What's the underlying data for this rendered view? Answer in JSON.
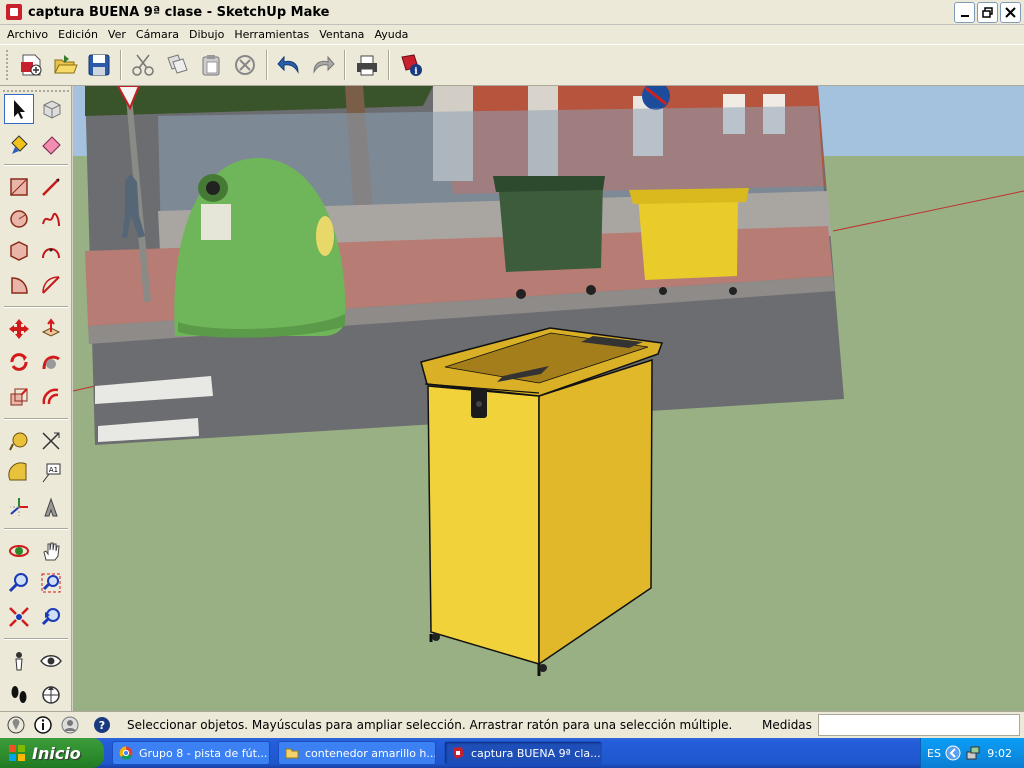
{
  "window": {
    "title": "captura BUENA 9ª clase - SketchUp Make"
  },
  "menu": [
    "Archivo",
    "Edición",
    "Ver",
    "Cámara",
    "Dibujo",
    "Herramientas",
    "Ventana",
    "Ayuda"
  ],
  "toolbar_icons": [
    "new-file-icon",
    "open-folder-icon",
    "save-icon",
    "cut-icon",
    "copy-icon",
    "paste-icon",
    "erase-icon",
    "undo-icon",
    "redo-icon",
    "print-icon",
    "model-info-icon"
  ],
  "palette_icons": [
    "select-icon",
    "make-component-icon",
    "paint-bucket-icon",
    "eraser-icon",
    "rectangle-icon",
    "line-icon",
    "circle-icon",
    "freehand-icon",
    "polygon-icon",
    "arc-icon",
    "pie-icon",
    "arc-2pt-icon",
    "move-icon",
    "push-pull-icon",
    "rotate-icon",
    "follow-me-icon",
    "scale-icon",
    "offset-icon",
    "tape-measure-icon",
    "dimension-icon",
    "protractor-icon",
    "text-icon",
    "axes-icon",
    "3d-text-icon",
    "orbit-icon",
    "pan-icon",
    "zoom-icon",
    "zoom-window-icon",
    "zoom-extents-icon",
    "previous-view-icon",
    "position-camera-icon",
    "look-around-icon",
    "walk-icon",
    "section-plane-icon"
  ],
  "status": {
    "text": "Seleccionar objetos. Mayúsculas para ampliar selección. Arrastrar ratón para una selección múltiple.",
    "measure_label": "Medidas",
    "measure_value": ""
  },
  "taskbar": {
    "start_label": "Inicio",
    "tasks": [
      {
        "label": "Grupo 8 - pista de fút...",
        "icon": "chrome-icon",
        "active": false
      },
      {
        "label": "contenedor amarillo h...",
        "icon": "folder-icon",
        "active": false
      },
      {
        "label": "captura BUENA 9ª cla...",
        "icon": "sketchup-icon",
        "active": true
      }
    ],
    "lang": "ES",
    "clock": "9:02"
  },
  "colors": {
    "sky": "#a3c0dc",
    "ground": "#98b083",
    "bin_yellow": "#f2d23a",
    "bin_side": "#e0b82a"
  }
}
